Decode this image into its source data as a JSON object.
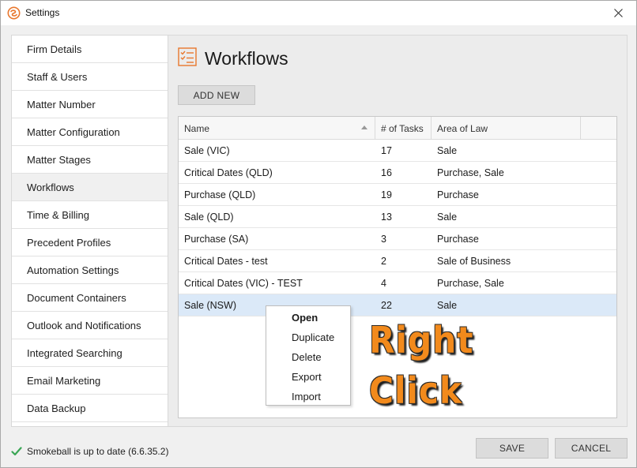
{
  "window": {
    "title": "Settings"
  },
  "sidebar": {
    "items": [
      {
        "label": "Firm Details"
      },
      {
        "label": "Staff & Users"
      },
      {
        "label": "Matter Number"
      },
      {
        "label": "Matter Configuration"
      },
      {
        "label": "Matter Stages"
      },
      {
        "label": "Workflows",
        "active": true
      },
      {
        "label": "Time & Billing"
      },
      {
        "label": "Precedent Profiles"
      },
      {
        "label": "Automation Settings"
      },
      {
        "label": "Document Containers"
      },
      {
        "label": "Outlook and Notifications"
      },
      {
        "label": "Integrated Searching"
      },
      {
        "label": "Email Marketing"
      },
      {
        "label": "Data Backup"
      }
    ]
  },
  "main": {
    "title": "Workflows",
    "add_new_label": "ADD NEW",
    "table": {
      "columns": [
        "Name",
        "# of Tasks",
        "Area of Law"
      ],
      "rows": [
        {
          "name": "Sale (VIC)",
          "tasks": "17",
          "area": "Sale"
        },
        {
          "name": "Critical Dates (QLD)",
          "tasks": "16",
          "area": "Purchase, Sale"
        },
        {
          "name": "Purchase (QLD)",
          "tasks": "19",
          "area": "Purchase"
        },
        {
          "name": "Sale (QLD)",
          "tasks": "13",
          "area": "Sale"
        },
        {
          "name": "Purchase (SA)",
          "tasks": "3",
          "area": "Purchase"
        },
        {
          "name": "Critical Dates - test",
          "tasks": "2",
          "area": "Sale of Business"
        },
        {
          "name": "Critical Dates (VIC) - TEST",
          "tasks": "4",
          "area": "Purchase, Sale"
        },
        {
          "name": "Sale (NSW)",
          "tasks": "22",
          "area": "Sale",
          "selected": true
        }
      ]
    }
  },
  "context_menu": {
    "items": [
      "Open",
      "Duplicate",
      "Delete",
      "Export",
      "Import"
    ]
  },
  "annotation": {
    "line1": "Right",
    "line2": "Click"
  },
  "footer": {
    "status": "Smokeball is up to date (6.6.35.2)",
    "save_label": "SAVE",
    "cancel_label": "CANCEL"
  },
  "colors": {
    "accent": "#e8772e",
    "selected_row": "#dbe9f8",
    "status_check": "#3aa655",
    "annotation": "#f28a1c"
  },
  "icons": {
    "app_logo": "smokeball-logo-icon",
    "close": "close-icon",
    "page": "checklist-icon",
    "status": "checkmark-icon"
  }
}
